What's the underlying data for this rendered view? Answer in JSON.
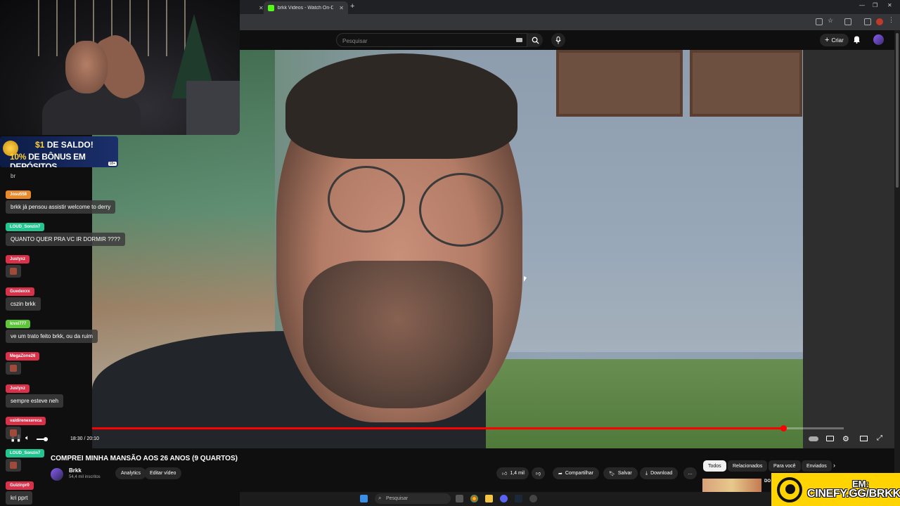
{
  "browser": {
    "tabs": [
      {
        "label": "brkk Videos - Watch On-Demand",
        "active": true
      }
    ],
    "new_tab_label": "+"
  },
  "youtube": {
    "search_placeholder": "Pesquisar",
    "create_label": "Criar"
  },
  "player": {
    "time": "18:30 / 20:10",
    "progress": 0.92
  },
  "video": {
    "title": "COMPREI MINHA MANSÃO AOS 26 ANOS (9 QUARTOS)",
    "channel_name": "Brkk",
    "subscribers": "54,4 mil inscritos",
    "analytics_label": "Analytics",
    "edit_label": "Editar vídeo",
    "likes": "1,4 mil",
    "share_label": "Compartilhar",
    "save_label": "Salvar",
    "download_label": "Download",
    "more_label": "…"
  },
  "filter_chips": [
    "Todos",
    "Relacionados",
    "Para você",
    "Enviados"
  ],
  "recommended_snippet": "DO",
  "taskbar": {
    "search_placeholder": "Pesquisar"
  },
  "promo": {
    "line1_amount": "$1",
    "line1_rest": " DE SALDO!",
    "line2_pct": "10%",
    "line2_rest": " DE BÔNUS EM DEPÓSITOS",
    "age": "18+"
  },
  "chat": {
    "top_fragment": "br",
    "messages": [
      {
        "user": "Josu558",
        "color": "#e8892b",
        "text": "brkk já pensou assistir welcome to derry"
      },
      {
        "user": "LOUD_Sonzin7",
        "color": "#22c58f",
        "text": "QUANTO QUER PRA VC IR DORMIR ????"
      },
      {
        "user": "Justyxz",
        "color": "#d8314a",
        "text": ""
      },
      {
        "user": "Guedexxx",
        "color": "#d8314a",
        "text": "cszin brkk"
      },
      {
        "user": "lcvxi777",
        "color": "#5ec43a",
        "text": "ve um trato feito brkk, ou da ruim"
      },
      {
        "user": "MegaZone26",
        "color": "#d8314a",
        "text": ""
      },
      {
        "user": "Justyxz",
        "color": "#d8314a",
        "text": "sempre esteve neh"
      },
      {
        "user": "valdirenexereca",
        "color": "#d8314a",
        "text": ""
      },
      {
        "user": "LOUD_Sonzin7",
        "color": "#22c58f",
        "text": ""
      },
      {
        "user": "Guizinpr0",
        "color": "#d8314a",
        "text": "kri pprt"
      }
    ]
  },
  "cinefy": {
    "line1": "EM:",
    "line2": "CINEFY.GG/BRKK"
  },
  "colors": {
    "youtube_red": "#ff0000",
    "cinefy_yellow": "#ffd400",
    "kick_green": "#53fc18"
  }
}
